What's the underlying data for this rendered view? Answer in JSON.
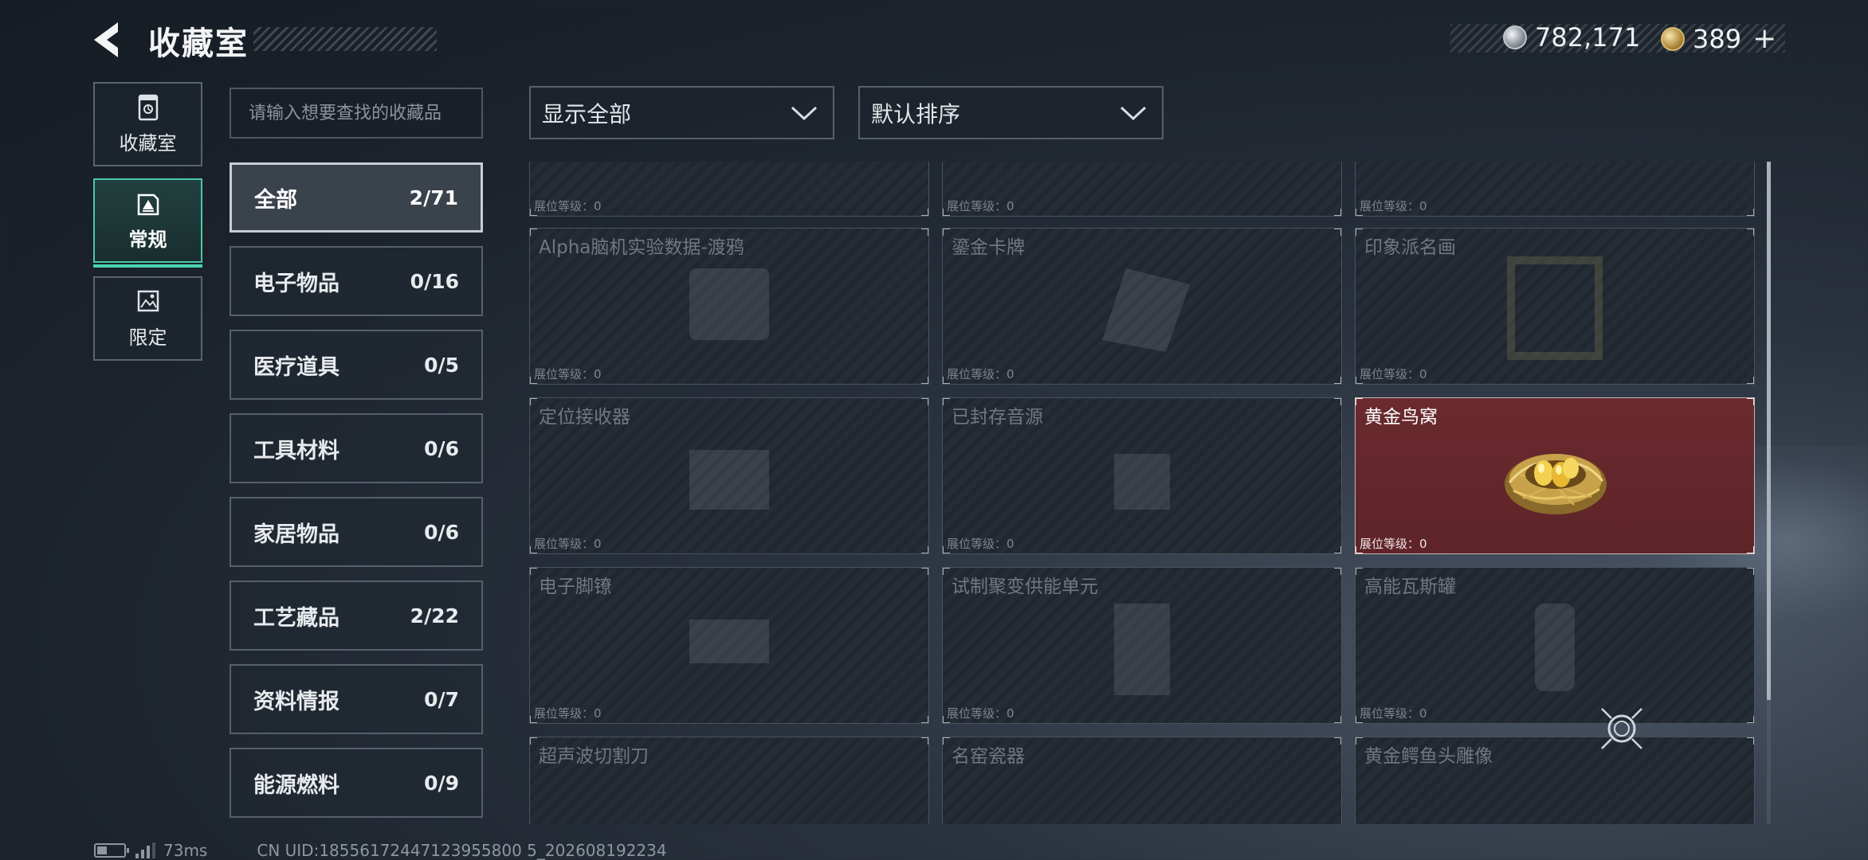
{
  "header": {
    "title": "收藏室",
    "currency_silver": "782,171",
    "currency_gold": "389",
    "plus_label": "+"
  },
  "side_tabs": [
    {
      "label": "收藏室",
      "icon": "collection-room-icon"
    },
    {
      "label": "常规",
      "icon": "regular-icon"
    },
    {
      "label": "限定",
      "icon": "limited-icon"
    }
  ],
  "search": {
    "placeholder": "请输入想要查找的收藏品"
  },
  "categories": [
    {
      "name": "全部",
      "count": "2/71"
    },
    {
      "name": "电子物品",
      "count": "0/16"
    },
    {
      "name": "医疗道具",
      "count": "0/5"
    },
    {
      "name": "工具材料",
      "count": "0/6"
    },
    {
      "name": "家居物品",
      "count": "0/6"
    },
    {
      "name": "工艺藏品",
      "count": "2/22"
    },
    {
      "name": "资料情报",
      "count": "0/7"
    },
    {
      "name": "能源燃料",
      "count": "0/9"
    }
  ],
  "filters": {
    "display": "显示全部",
    "sort": "默认排序"
  },
  "cards": [
    {
      "name": "",
      "level": "展位等级：0"
    },
    {
      "name": "",
      "level": "展位等级：0"
    },
    {
      "name": "",
      "level": "展位等级：0"
    },
    {
      "name": "Alpha脑机实验数据-渡鸦",
      "level": "展位等级：0"
    },
    {
      "name": "鎏金卡牌",
      "level": "展位等级：0"
    },
    {
      "name": "印象派名画",
      "level": "展位等级：0"
    },
    {
      "name": "定位接收器",
      "level": "展位等级：0"
    },
    {
      "name": "已封存音源",
      "level": "展位等级：0"
    },
    {
      "name": "黄金鸟窝",
      "level": "展位等级：0"
    },
    {
      "name": "电子脚镣",
      "level": "展位等级：0"
    },
    {
      "name": "试制聚变供能单元",
      "level": "展位等级：0"
    },
    {
      "name": "高能瓦斯罐",
      "level": "展位等级：0"
    },
    {
      "name": "超声波切割刀",
      "level": ""
    },
    {
      "name": "名窑瓷器",
      "level": ""
    },
    {
      "name": "黄金鳄鱼头雕像",
      "level": ""
    }
  ],
  "footer": {
    "ping": "73ms",
    "uid": "CN UID:18556172447123955800 5_202608192234"
  },
  "colors": {
    "accent": "#49d4b0",
    "unlocked_card": "#6a2a2e"
  }
}
